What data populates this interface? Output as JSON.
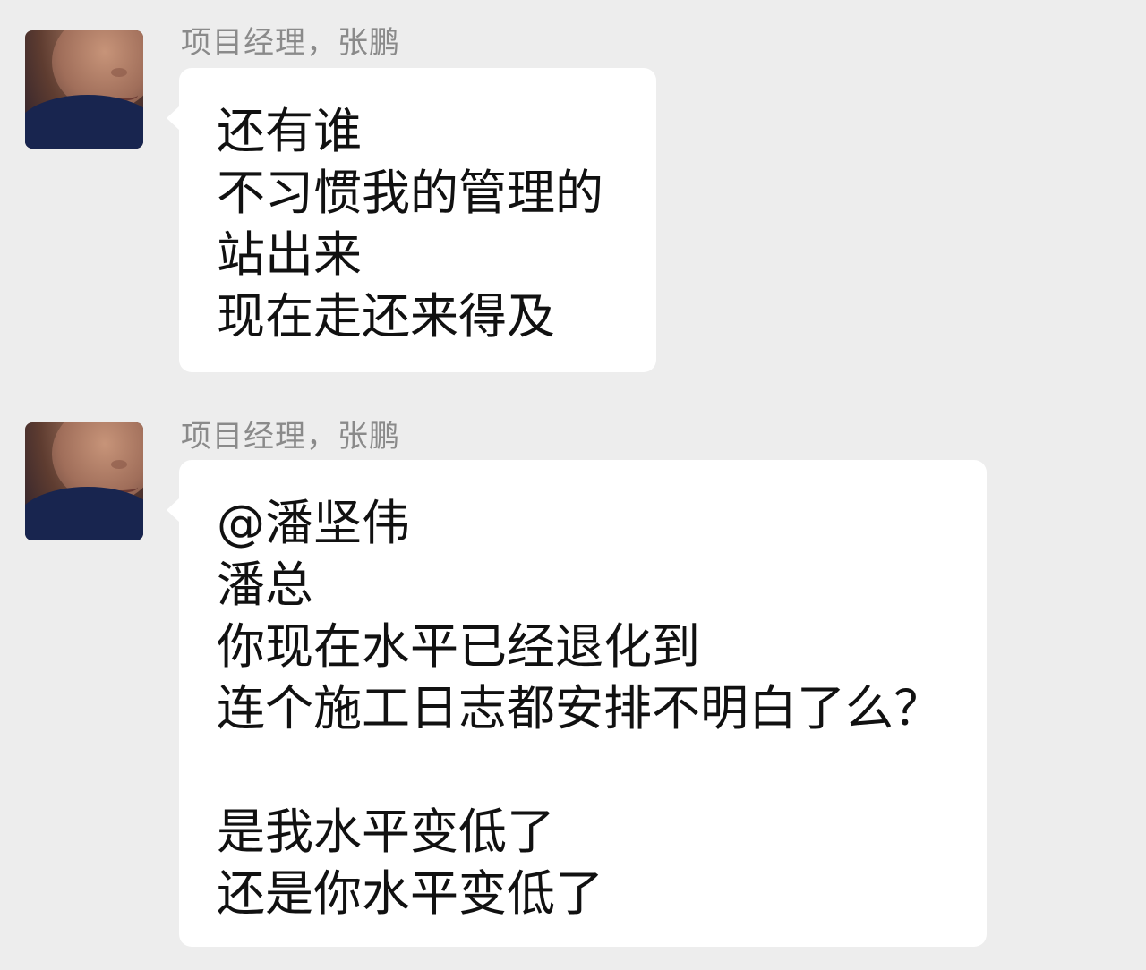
{
  "messages": [
    {
      "sender": "项目经理，张鹏",
      "lines": [
        "还有谁",
        "不习惯我的管理的",
        "站出来",
        "现在走还来得及"
      ]
    },
    {
      "sender": "项目经理，张鹏",
      "lines": [
        "@潘坚伟",
        "潘总",
        "你现在水平已经退化到",
        "连个施工日志都安排不明白了么？",
        "",
        "是我水平变低了",
        "还是你水平变低了"
      ]
    }
  ],
  "colors": {
    "background": "#ededed",
    "bubble": "#ffffff",
    "sender_text": "#8a8a8a",
    "message_text": "#111111"
  }
}
